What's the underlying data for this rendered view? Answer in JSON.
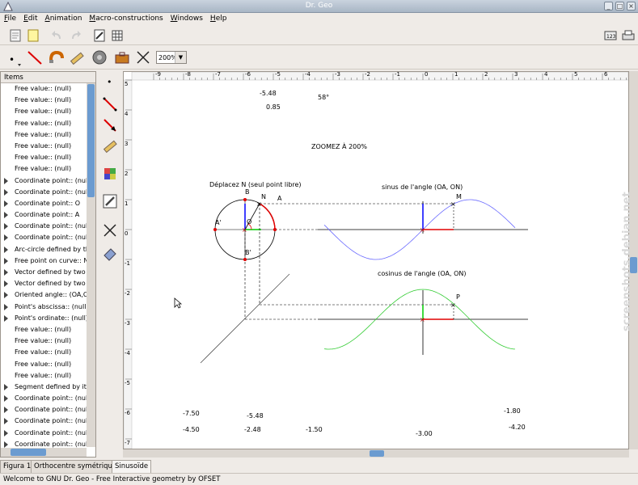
{
  "window": {
    "title": "Dr. Geo"
  },
  "menu": [
    {
      "pre": "",
      "u": "F",
      "post": "ile"
    },
    {
      "pre": "",
      "u": "E",
      "post": "dit"
    },
    {
      "pre": "",
      "u": "A",
      "post": "nimation"
    },
    {
      "pre": "",
      "u": "M",
      "post": "acro-constructions"
    },
    {
      "pre": "",
      "u": "W",
      "post": "indows"
    },
    {
      "pre": "",
      "u": "H",
      "post": "elp"
    }
  ],
  "toolbar": {
    "zoom_value": "200%"
  },
  "items_panel": {
    "header": "Items",
    "items": [
      {
        "label": "Free value:: (null)",
        "expandable": false
      },
      {
        "label": "Free value:: (null)",
        "expandable": false
      },
      {
        "label": "Free value:: (null)",
        "expandable": false
      },
      {
        "label": "Free value:: (null)",
        "expandable": false
      },
      {
        "label": "Free value:: (null)",
        "expandable": false
      },
      {
        "label": "Free value:: (null)",
        "expandable": false
      },
      {
        "label": "Free value:: (null)",
        "expandable": false
      },
      {
        "label": "Free value:: (null)",
        "expandable": false
      },
      {
        "label": "Coordinate point:: (nul",
        "expandable": true
      },
      {
        "label": "Coordinate point:: (nul",
        "expandable": true
      },
      {
        "label": "Coordinate point:: O",
        "expandable": true
      },
      {
        "label": "Coordinate point:: A",
        "expandable": true
      },
      {
        "label": "Coordinate point:: (nul",
        "expandable": true
      },
      {
        "label": "Coordinate point:: (nul",
        "expandable": true
      },
      {
        "label": "Arc-circle defined by th",
        "expandable": true
      },
      {
        "label": "Free point on curve:: N",
        "expandable": true
      },
      {
        "label": "Vector defined by two",
        "expandable": true
      },
      {
        "label": "Vector defined by two",
        "expandable": true
      },
      {
        "label": "Oriented angle:: (OA,O",
        "expandable": true
      },
      {
        "label": "Point's abscissa:: (null",
        "expandable": true
      },
      {
        "label": "Point's ordinate:: (null)",
        "expandable": true
      },
      {
        "label": "Free value:: (null)",
        "expandable": false
      },
      {
        "label": "Free value:: (null)",
        "expandable": false
      },
      {
        "label": "Free value:: (null)",
        "expandable": false
      },
      {
        "label": "Free value:: (null)",
        "expandable": false
      },
      {
        "label": "Free value:: (null)",
        "expandable": false
      },
      {
        "label": "Segment defined by it",
        "expandable": true
      },
      {
        "label": "Coordinate point:: (nul",
        "expandable": true
      },
      {
        "label": "Coordinate point:: (nul",
        "expandable": true
      },
      {
        "label": "Coordinate point:: (nul",
        "expandable": true
      },
      {
        "label": "Coordinate point:: (nul",
        "expandable": true
      },
      {
        "label": "Coordinate point:: (nul",
        "expandable": true
      }
    ]
  },
  "canvas": {
    "ruler_top": [
      "-9",
      "-8",
      "-7",
      "-6",
      "-5",
      "-4",
      "-3",
      "-2",
      "-1",
      "0",
      "1",
      "2",
      "3",
      "4",
      "5",
      "6"
    ],
    "ruler_left": [
      "5",
      "4",
      "3",
      "2",
      "1",
      "0",
      "-1",
      "-2",
      "-3",
      "-4",
      "-5",
      "-6",
      "-7"
    ],
    "values": {
      "v1": "-5.48",
      "v2": "0.85",
      "v3": "58°",
      "v4": "-7.50",
      "v5": "-4.50",
      "v6": "-5.48",
      "v7": "-2.48",
      "v8": "-1.50",
      "v9": "-3.00",
      "v10": "-1.80",
      "v11": "-4.20"
    },
    "texts": {
      "zoom_note": "ZOOMEZ À 200%",
      "move_note": "Déplacez N (seul point libre)",
      "sin_title": "sinus de l'angle (OA, ON)",
      "cos_title": "cosinus de l'angle (OA, ON)"
    },
    "points": {
      "A": "A",
      "A_prime": "A'",
      "B": "B",
      "B_prime": "B'",
      "N": "N",
      "O": "O",
      "M": "M",
      "P": "P"
    },
    "colors": {
      "sine": "#6a6aff",
      "cosine": "#33cc33",
      "axis": "#000000",
      "red": "#e00000",
      "blue": "#0000ff",
      "green": "#00cc00"
    }
  },
  "tabs": [
    {
      "label": "Figura 1",
      "active": false
    },
    {
      "label": "Orthocentre symétrique",
      "active": false
    },
    {
      "label": "Sinusoïde",
      "active": true
    }
  ],
  "status": {
    "text": "Welcome to GNU Dr. Geo - Free Interactive geometry by OFSET"
  },
  "watermark": {
    "text": "screenshots.debian.net"
  }
}
